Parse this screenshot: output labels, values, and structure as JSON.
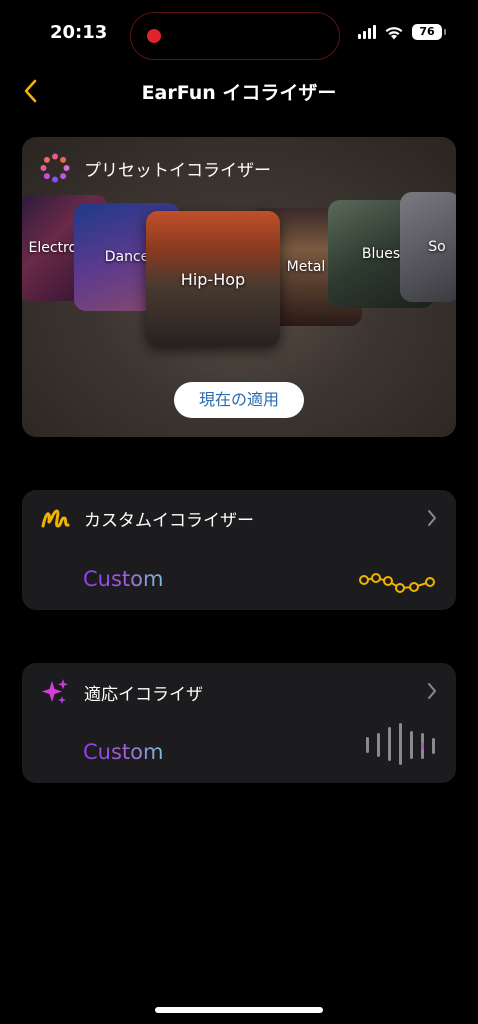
{
  "status_bar": {
    "time": "20:13",
    "battery": "76"
  },
  "header": {
    "title": "EarFun イコライザー"
  },
  "preset": {
    "title": "プリセットイコライザー",
    "tiles": [
      "Electronic",
      "Dance",
      "Hip-Hop",
      "Metal",
      "Blues",
      "So"
    ],
    "apply_label": "現在の適用"
  },
  "custom_eq": {
    "title": "カスタムイコライザー",
    "value": "Custom"
  },
  "adaptive_eq": {
    "title": "適応イコライザ",
    "value": "Custom"
  },
  "colors": {
    "accent": "#f0b400",
    "purple": "#8b3ff0",
    "background": "#000000",
    "card": "#1c1b1e"
  }
}
